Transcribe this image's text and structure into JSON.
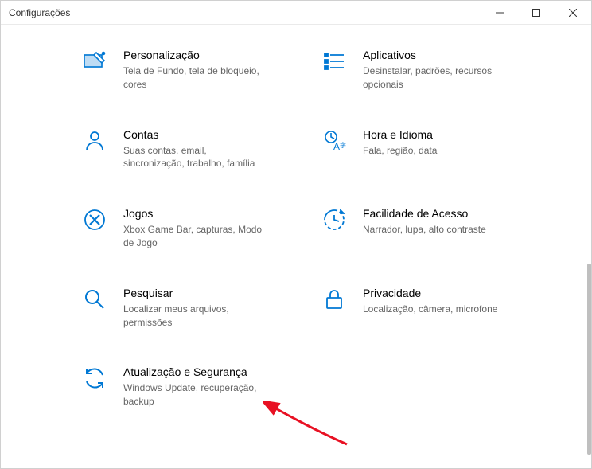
{
  "titlebar": {
    "title": "Configurações"
  },
  "items": [
    {
      "title": "Personalização",
      "desc": "Tela de Fundo, tela de bloqueio, cores"
    },
    {
      "title": "Aplicativos",
      "desc": "Desinstalar, padrões, recursos opcionais"
    },
    {
      "title": "Contas",
      "desc": "Suas contas, email, sincronização, trabalho, família"
    },
    {
      "title": "Hora e Idioma",
      "desc": "Fala, região, data"
    },
    {
      "title": "Jogos",
      "desc": "Xbox Game Bar, capturas, Modo de Jogo"
    },
    {
      "title": "Facilidade de Acesso",
      "desc": "Narrador, lupa, alto contraste"
    },
    {
      "title": "Pesquisar",
      "desc": "Localizar meus arquivos, permissões"
    },
    {
      "title": "Privacidade",
      "desc": "Localização, câmera, microfone"
    },
    {
      "title": "Atualização e Segurança",
      "desc": "Windows Update, recuperação, backup"
    }
  ]
}
